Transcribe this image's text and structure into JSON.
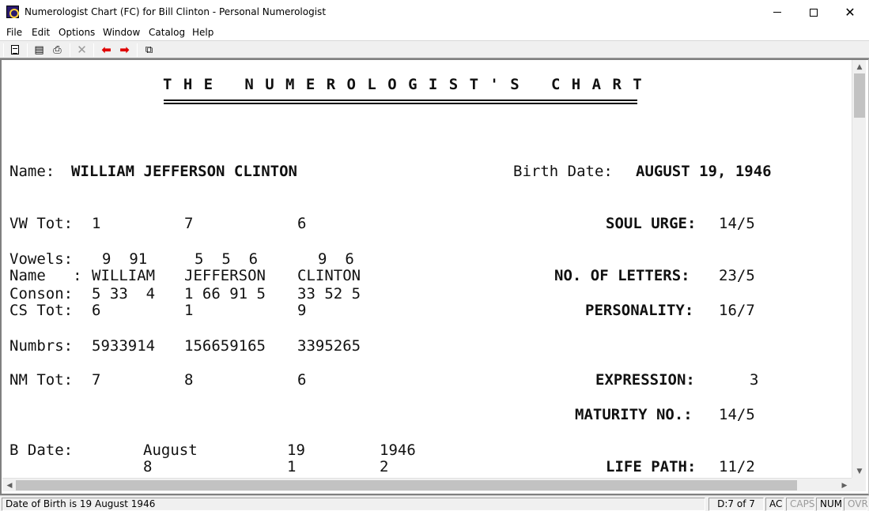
{
  "window": {
    "title": "Numerologist Chart (FC) for Bill Clinton - Personal Numerologist",
    "close_glyph": "✕"
  },
  "menu": [
    "File",
    "Edit",
    "Options",
    "Window",
    "Catalog",
    "Help"
  ],
  "toolbar": {
    "icons": [
      "new-document-icon",
      "view-icon",
      "print-icon",
      "delete-icon",
      "back-arrow-icon",
      "forward-arrow-icon",
      "copy-icon"
    ],
    "glyphs": {
      "view": "▤",
      "print": "⎙",
      "delete": "✕",
      "back": "⬅",
      "forward": "➡",
      "copy": "⧉"
    }
  },
  "chart": {
    "heading": "THE NUMEROLOGIST'S CHART",
    "name_label": "Name:",
    "name_value": "WILLIAM JEFFERSON CLINTON",
    "birth_label": "Birth Date:",
    "birth_value": "AUGUST 19, 1946",
    "vw_tot": {
      "label": "VW Tot:",
      "values": [
        "1",
        "7",
        "6"
      ]
    },
    "vowels": {
      "label": "Vowels:",
      "rows": [
        "9  91",
        "5  5  6",
        "9  6"
      ]
    },
    "name_row": {
      "label": "Name   :",
      "words": [
        "WILLIAM",
        "JEFFERSON",
        "CLINTON"
      ]
    },
    "conson": {
      "label": "Conson:",
      "rows": [
        "5 33  4",
        "1 66 91 5",
        "33 52 5"
      ]
    },
    "cs_tot": {
      "label": "CS Tot:",
      "values": [
        "6",
        "1",
        "9"
      ]
    },
    "numbrs": {
      "label": "Numbrs:",
      "values": [
        "5933914",
        "156659165",
        "3395265"
      ]
    },
    "nm_tot": {
      "label": "NM Tot:",
      "values": [
        "7",
        "8",
        "6"
      ]
    },
    "bdate": {
      "label": "B Date:",
      "parts": [
        "August",
        "19",
        "1946"
      ],
      "digits": [
        "8",
        "1",
        "2"
      ]
    },
    "results": [
      {
        "label": "SOUL URGE:",
        "value": "14/5"
      },
      {
        "label": "NO. OF LETTERS:",
        "value": "23/5"
      },
      {
        "label": "PERSONALITY:",
        "value": "16/7"
      },
      {
        "label": "EXPRESSION:",
        "value": "3"
      },
      {
        "label": "MATURITY NO.:",
        "value": "14/5"
      },
      {
        "label": "LIFE PATH:",
        "value": "11/2"
      }
    ]
  },
  "status": {
    "message": "Date of Birth is 19 August 1946",
    "page": "D:7 of 7",
    "ac": "AC",
    "caps": "CAPS",
    "num": "NUM",
    "ovr": "OVR"
  }
}
